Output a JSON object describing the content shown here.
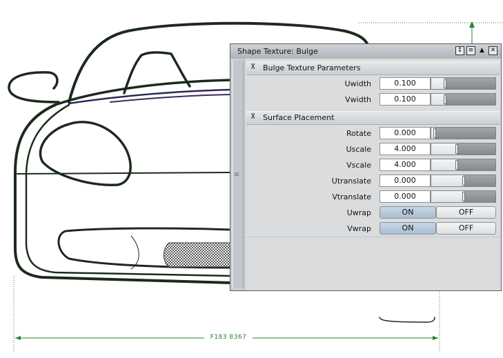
{
  "viewport": {
    "dimension_label": "F183 8367",
    "line_color": "#2e7d2e",
    "outline_color": "#1c2a1c"
  },
  "panel": {
    "title": "Shape Texture: Bulge",
    "title_icons": [
      "pin-icon",
      "menu-icon",
      "collapse-up-icon",
      "close-icon"
    ],
    "sections": [
      {
        "title": "Bulge Texture Parameters",
        "rows": [
          {
            "label": "Uwidth",
            "value": "0.100",
            "slider_fraction": 0.22
          },
          {
            "label": "Vwidth",
            "value": "0.100",
            "slider_fraction": 0.22
          }
        ]
      },
      {
        "title": "Surface Placement",
        "rows": [
          {
            "label": "Rotate",
            "value": "0.000",
            "slider_fraction": 0.05
          },
          {
            "label": "Uscale",
            "value": "4.000",
            "slider_fraction": 0.4
          },
          {
            "label": "Vscale",
            "value": "4.000",
            "slider_fraction": 0.4
          },
          {
            "label": "Utranslate",
            "value": "0.000",
            "slider_fraction": 0.5
          },
          {
            "label": "Vtranslate",
            "value": "0.000",
            "slider_fraction": 0.5
          }
        ],
        "toggles": [
          {
            "label": "Uwrap",
            "on_label": "ON",
            "off_label": "OFF",
            "selected": "ON"
          },
          {
            "label": "Vwrap",
            "on_label": "ON",
            "off_label": "OFF",
            "selected": "ON"
          }
        ]
      }
    ]
  }
}
